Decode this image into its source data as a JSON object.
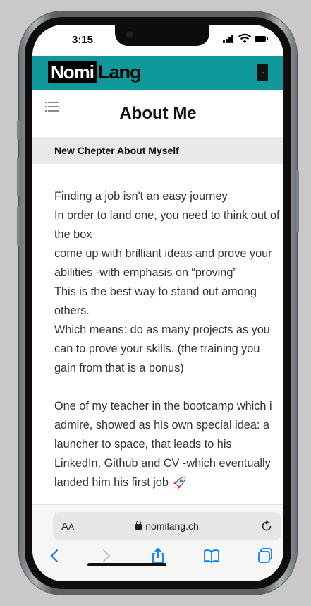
{
  "status_bar": {
    "time": "3:15",
    "icons": [
      "cellular-signal-icon",
      "wifi-icon",
      "battery-icon"
    ]
  },
  "app": {
    "logo_part1": "Nomi",
    "logo_part2": "Lang",
    "brand_color": "#10999b",
    "icons": [
      "menu-icon",
      "door-exit-icon"
    ]
  },
  "page": {
    "title": "About Me",
    "section_heading": "New Chepter About Myself",
    "paragraphs": [
      [
        "Finding a job isn't an easy journey",
        "In order to land one, you need to think out of the box",
        "come up with brilliant ideas and prove your abilities -with emphasis on “proving”",
        "This is the best way to stand out among others.",
        "Which means: do as many projects as you can to prove your skills. (the training you gain from that is a bonus)"
      ],
      [
        "One of my teacher in the bootcamp which i admire, showed as his own special idea: a launcher to space, that leads to his LinkedIn, Github and CV -which eventually landed him his first job"
      ]
    ],
    "inline_icon": "rocket-icon"
  },
  "browser": {
    "aa_label_big": "A",
    "aa_label_small": "A",
    "url": "nomilang.ch",
    "accent_color": "#007aff",
    "toolbar_icons": [
      "back-icon",
      "forward-icon",
      "share-icon",
      "bookmarks-icon",
      "tabs-icon"
    ]
  }
}
